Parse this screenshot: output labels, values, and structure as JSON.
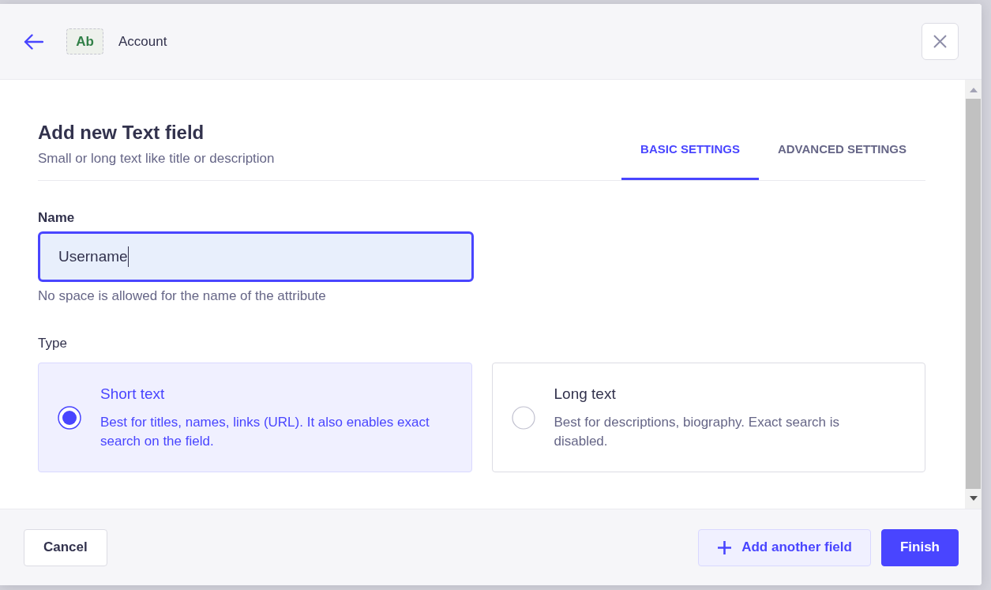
{
  "header": {
    "badge": "Ab",
    "title": "Account"
  },
  "form": {
    "title": "Add new Text field",
    "subtitle": "Small or long text like title or description",
    "tabs": [
      {
        "label": "BASIC SETTINGS",
        "selected": true
      },
      {
        "label": "ADVANCED SETTINGS",
        "selected": false
      }
    ],
    "name_field": {
      "label": "Name",
      "value": "Username",
      "focused": true,
      "hint": "No space is allowed for the name of the attribute"
    },
    "type_field": {
      "label": "Type",
      "options": [
        {
          "title": "Short text",
          "description": "Best for titles, names, links (URL). It also enables exact search on the field.",
          "selected": true
        },
        {
          "title": "Long text",
          "description": "Best for descriptions, biography. Exact search is disabled.",
          "selected": false
        }
      ]
    }
  },
  "footer": {
    "buttons": [
      {
        "label": "Cancel",
        "kind": "secondary"
      },
      {
        "label": "Add another field",
        "kind": "add"
      },
      {
        "label": "Finish",
        "kind": "primary"
      }
    ]
  }
}
